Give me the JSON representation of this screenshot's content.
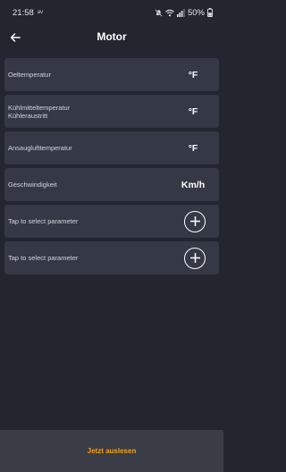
{
  "status_bar": {
    "time": "21:58",
    "small_label": "av",
    "battery": "50%"
  },
  "header": {
    "title": "Motor",
    "back_icon": "arrow-left-icon"
  },
  "parameters": [
    {
      "label_lines": [
        "Oeltemperatur"
      ],
      "unit": "°F"
    },
    {
      "label_lines": [
        "Kühlmitteltemperatur",
        "Kühleraustritt"
      ],
      "unit": "°F"
    },
    {
      "label_lines": [
        "Ansauglufttemperatur"
      ],
      "unit": "°F"
    },
    {
      "label_lines": [
        "Geschwindigkeit"
      ],
      "unit": "Km/h"
    }
  ],
  "empty_slots": [
    {
      "label": "Tap to select parameter",
      "icon": "plus-circle-icon"
    },
    {
      "label": "Tap to select parameter",
      "icon": "plus-circle-icon"
    }
  ],
  "footer": {
    "action_label": "Jetzt auslesen"
  },
  "colors": {
    "background": "#23252f",
    "row": "#353845",
    "footer": "#3a3c46",
    "accent": "#f5a116"
  }
}
